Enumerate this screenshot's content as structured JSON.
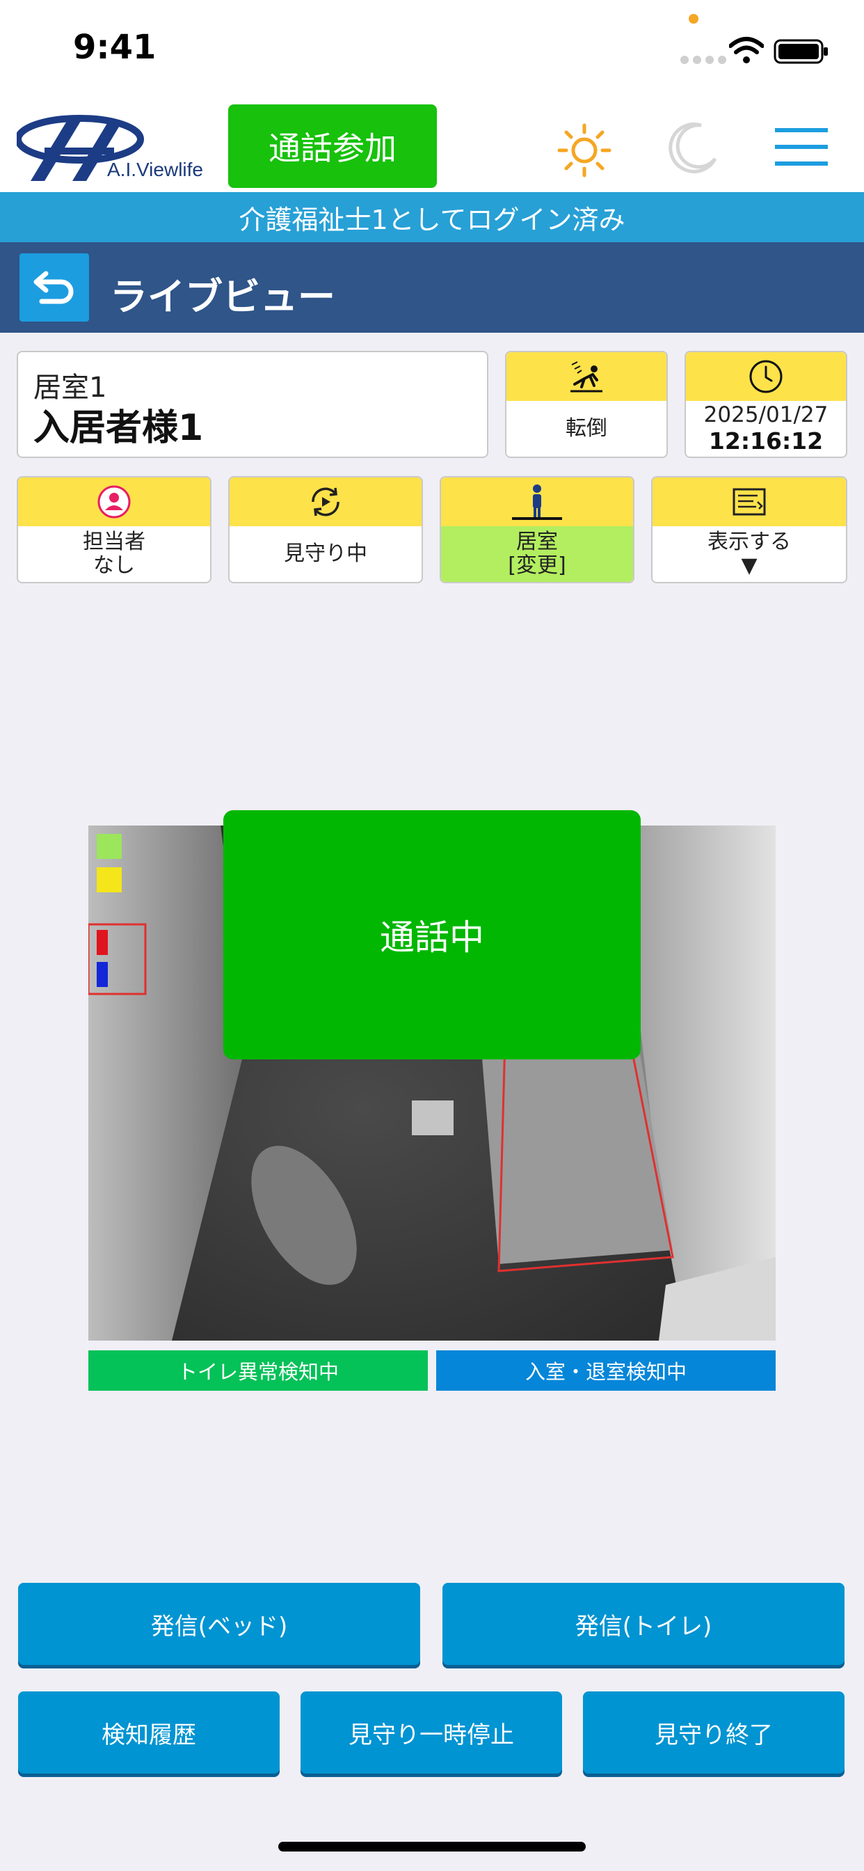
{
  "status_bar": {
    "time": "9:41"
  },
  "header": {
    "logo_text": "A.I.Viewlife",
    "call_join_label": "通話参加",
    "icons": [
      "sun-icon",
      "moon-icon",
      "menu-icon"
    ]
  },
  "login_banner": "介護福祉士1としてログイン済み",
  "title_bar": {
    "title": "ライブビュー",
    "back_icon": "back-arrow-icon"
  },
  "room_card": {
    "room": "居室1",
    "resident": "入居者様1"
  },
  "tiles_row1": {
    "fall": {
      "icon": "fall-icon",
      "label": "転倒"
    },
    "clock": {
      "icon": "clock-icon",
      "date": "2025/01/27",
      "time": "12:16:12"
    }
  },
  "tiles_row2": [
    {
      "icon": "person-badge-icon",
      "line1": "担当者",
      "line2": "なし"
    },
    {
      "icon": "refresh-play-icon",
      "line1": "見守り中",
      "line2": ""
    },
    {
      "icon": "standing-person-icon",
      "line1": "居室",
      "line2": "[変更]"
    },
    {
      "icon": "list-icon",
      "line1": "表示する",
      "line2": "▼"
    }
  ],
  "camera": {
    "overlay_text": "通話中"
  },
  "status_strips": {
    "toilet": {
      "label": "トイレ異常検知中",
      "color": "#04c158"
    },
    "entry": {
      "label": "入室・退室検知中",
      "color": "#0586d8"
    }
  },
  "buttons": {
    "call_bed": "発信(ベッド)",
    "call_toilet": "発信(トイレ)",
    "history": "検知履歴",
    "pause": "見守り一時停止",
    "end": "見守り終了"
  },
  "colors": {
    "accent_green": "#17c10c",
    "banner_blue": "#27a0d6",
    "title_navy": "#2f5589",
    "tile_yellow": "#fde24a",
    "button_blue": "#0094d2"
  }
}
